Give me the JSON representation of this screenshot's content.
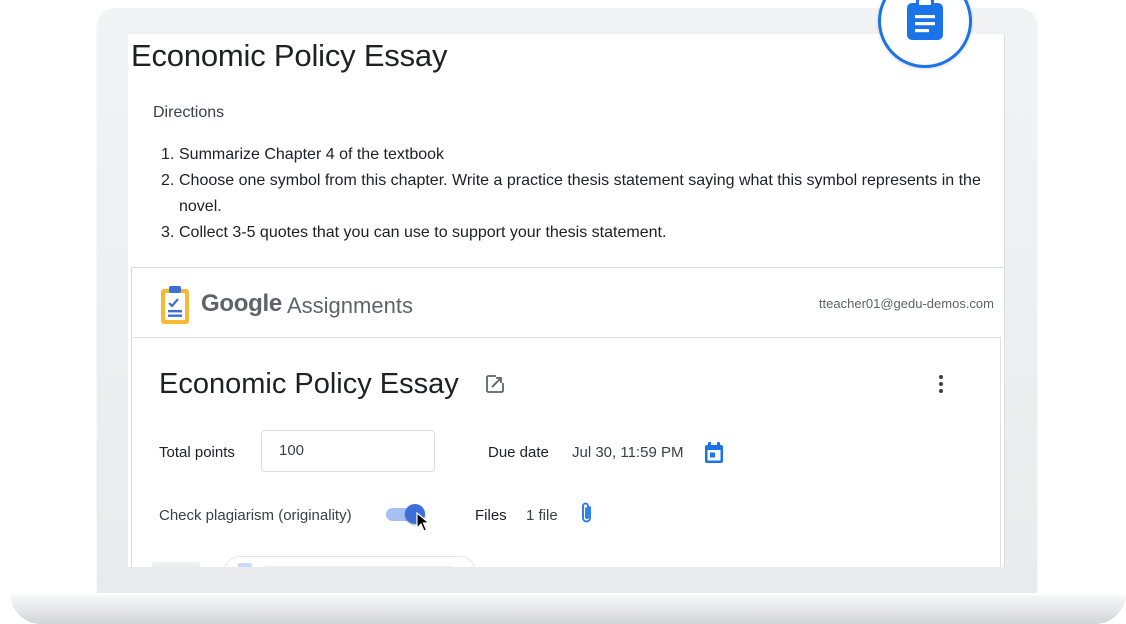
{
  "document": {
    "title": "Economic Policy Essay",
    "directions_heading": "Directions",
    "directions": [
      {
        "num": "1.",
        "text": "Summarize Chapter 4 of the textbook"
      },
      {
        "num": "2.",
        "text": "Choose one symbol from this chapter. Write a practice thesis statement saying what this symbol represents in the novel."
      },
      {
        "num": "3.",
        "text": "Collect 3-5 quotes that you can use to support your thesis statement."
      }
    ]
  },
  "assignments": {
    "brand_google": "Google",
    "brand_product": "Assignments",
    "user_email": "tteacher01@gedu-demos.com",
    "title": "Economic Policy Essay",
    "total_points_label": "Total points",
    "total_points_value": "100",
    "due_date_label": "Due date",
    "due_date_value": "Jul 30, 11:59 PM",
    "plagiarism_label": "Check plagiarism (originality)",
    "plagiarism_enabled": true,
    "files_label": "Files",
    "files_value": "1 file"
  },
  "icons": {
    "badge": "clipboard-icon",
    "brand": "assignments-logo-icon",
    "open": "open-in-new-icon",
    "more": "more-vert-icon",
    "calendar": "calendar-icon",
    "attach": "paperclip-icon",
    "cursor": "mouse-pointer-icon"
  },
  "colors": {
    "accent": "#1a73e8",
    "toggle_on": "#3c6fd8",
    "brand_yellow": "#f6b933"
  }
}
